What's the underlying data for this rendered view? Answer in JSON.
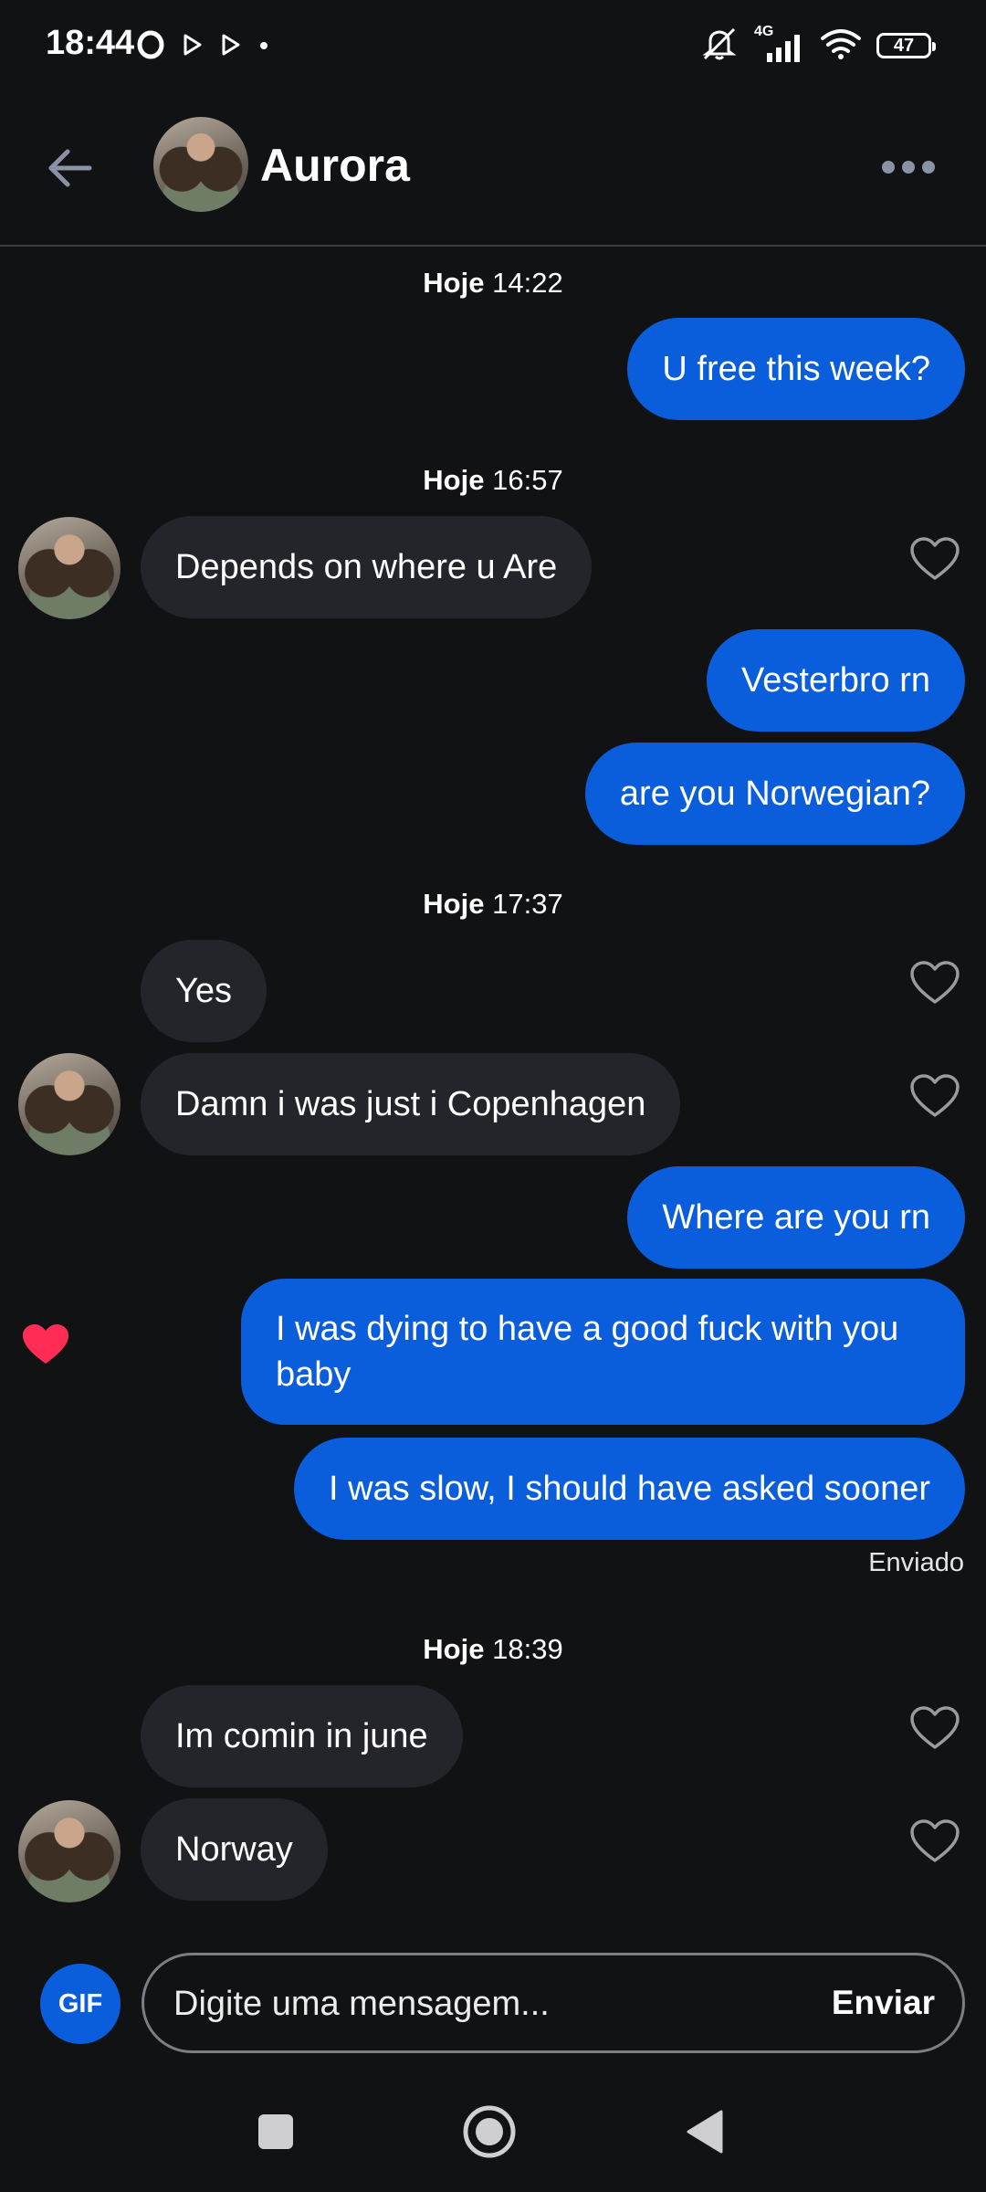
{
  "status_bar": {
    "time": "18:44",
    "network": "4G",
    "battery": "47"
  },
  "header": {
    "contact_name": "Aurora"
  },
  "timestamps": [
    {
      "day": "Hoje",
      "time": "14:22"
    },
    {
      "day": "Hoje",
      "time": "16:57"
    },
    {
      "day": "Hoje",
      "time": "17:37"
    },
    {
      "day": "Hoje",
      "time": "18:39"
    }
  ],
  "messages": [
    {
      "text": "U free this week?",
      "direction": "sent"
    },
    {
      "text": "Depends on where u Are",
      "direction": "received"
    },
    {
      "text": "Vesterbro rn",
      "direction": "sent"
    },
    {
      "text": "are you Norwegian?",
      "direction": "sent"
    },
    {
      "text": "Yes",
      "direction": "received"
    },
    {
      "text": "Damn i was just i Copenhagen",
      "direction": "received"
    },
    {
      "text": "Where are you rn",
      "direction": "sent"
    },
    {
      "text": "I was dying to have a good fuck with you baby",
      "direction": "sent",
      "liked": true
    },
    {
      "text": "I was slow, I should have asked sooner",
      "direction": "sent"
    },
    {
      "text": "Im comin in june",
      "direction": "received"
    },
    {
      "text": "Norway",
      "direction": "received"
    }
  ],
  "delivery_status": "Enviado",
  "composer": {
    "gif_label": "GIF",
    "placeholder": "Digite uma mensagem...",
    "send_label": "Enviar"
  },
  "colors": {
    "background": "#111214",
    "sent_bubble": "#0a5ddb",
    "received_bubble": "#24252a",
    "like_heart": "#ff2d55"
  }
}
